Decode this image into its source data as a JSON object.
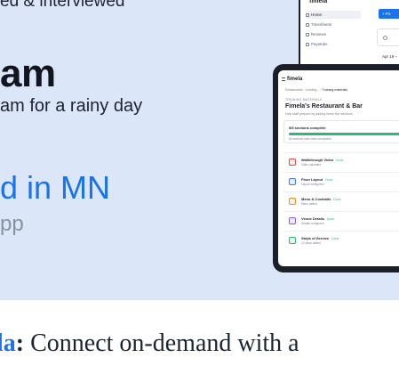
{
  "marketing": {
    "line_top": "ed & interviewed",
    "headline": "am",
    "subline": "am for a rainy day",
    "blue_line": "d in MN",
    "gray_line": "pp"
  },
  "desktop_app": {
    "brand": "fimela",
    "nav": [
      {
        "label": "Home",
        "icon": "home-icon",
        "active": true
      },
      {
        "label": "Timesheets",
        "icon": "clock-icon",
        "active": false
      },
      {
        "label": "Reviews",
        "icon": "star-icon",
        "active": false
      },
      {
        "label": "Paystubs",
        "icon": "document-icon",
        "active": false
      }
    ],
    "primary_button": "+ Po",
    "date": "Apr 19 –"
  },
  "tablet_app": {
    "brand": "fimela",
    "breadcrumb": {
      "root": "Restaurants",
      "mid": "Leading...",
      "current": "Training materials"
    },
    "section_label": "TRAINING MATERIALS",
    "title": "Fimela's Restaurant & Bar",
    "description": "Help staff prepare by adding these five sections",
    "progress": {
      "title": "5/5 sections complete",
      "fraction": 1.0,
      "note": "All sections have been completed"
    },
    "sections": [
      {
        "name": "Walkthrough Video",
        "status": "Done",
        "sub": "Video uploaded",
        "color": "#e5484d",
        "bg": "#fde8e8",
        "icon": "video-icon"
      },
      {
        "name": "Floor Layout",
        "status": "Done",
        "sub": "Layout configured",
        "color": "#3e7bfa",
        "bg": "#e4edff",
        "icon": "layout-icon"
      },
      {
        "name": "Menu & Cocktails",
        "status": "Done",
        "sub": "Menu added",
        "color": "#f08c2e",
        "bg": "#fff0e0",
        "icon": "menu-icon"
      },
      {
        "name": "Venue Details",
        "status": "Done",
        "sub": "Details configured",
        "color": "#8e5cf0",
        "bg": "#efe6ff",
        "icon": "venue-icon"
      },
      {
        "name": "Steps of Service",
        "status": "Done",
        "sub": "12 steps added",
        "color": "#2fb67a",
        "bg": "#e2f6ec",
        "icon": "steps-icon"
      }
    ]
  },
  "caption": {
    "brand": "la",
    "colon": ":",
    "text": " Connect on-demand with a"
  }
}
